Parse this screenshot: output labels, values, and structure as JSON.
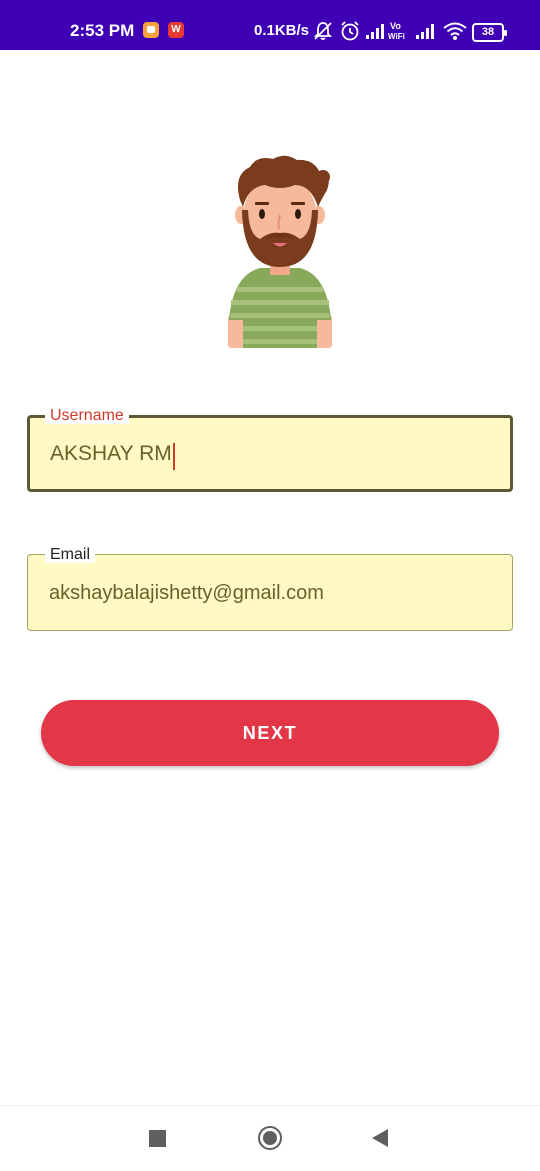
{
  "status_bar": {
    "time": "2:53 PM",
    "wps_badge": "W",
    "speed": "0.1KB/s",
    "vowifi": "Vo WiFi",
    "battery": "38",
    "background": "#3f00b5"
  },
  "form": {
    "username": {
      "label": "Username",
      "value": "AKSHAY RM"
    },
    "email": {
      "label": "Email",
      "value": "akshaybalajishetty@gmail.com"
    },
    "next_label": "NEXT"
  },
  "colors": {
    "accent": "#e33646",
    "field_fill": "#fff9c4",
    "focused_label": "#d03a2a"
  },
  "icons": [
    "avatar-illustration",
    "recents-icon",
    "home-icon",
    "back-icon"
  ]
}
